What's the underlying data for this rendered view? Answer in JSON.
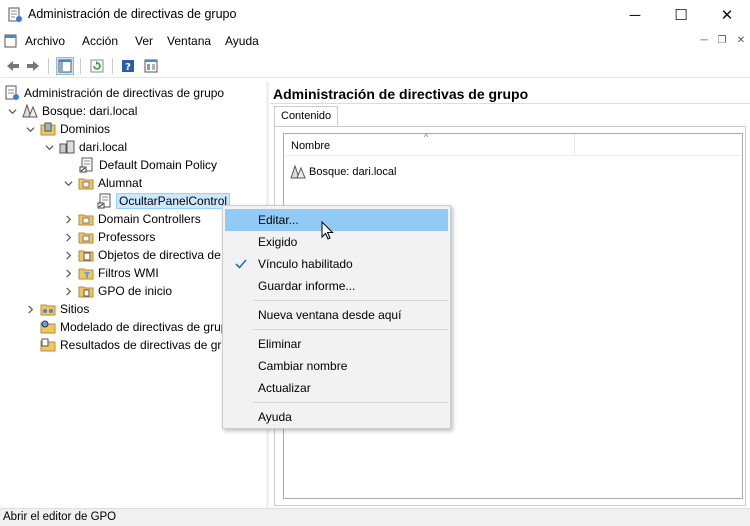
{
  "window": {
    "title": "Administración de directivas de grupo",
    "minimize_glyph": "─",
    "maximize_glyph": "☐",
    "close_glyph": "✕"
  },
  "menubar": {
    "items": [
      "Archivo",
      "Acción",
      "Ver",
      "Ventana",
      "Ayuda"
    ],
    "mdi_minimize_glyph": "─",
    "mdi_restore_glyph": "❐",
    "mdi_close_glyph": "✕"
  },
  "toolbar": {
    "buttons": [
      "back-icon",
      "forward-icon",
      "show-tree-icon",
      "refresh-icon",
      "help-icon",
      "properties-icon"
    ]
  },
  "tree": {
    "root": "Administración de directivas de grupo",
    "forest": "Bosque: dari.local",
    "domains": "Dominios",
    "domain": "dari.local",
    "default_policy": "Default Domain Policy",
    "alumnat": "Alumnat",
    "ocultar": "OcultarPanelControl",
    "domain_controllers": "Domain Controllers",
    "professors": "Professors",
    "gpo_objects": "Objetos de directiva de grupo",
    "wmi_filters": "Filtros WMI",
    "starter_gpos": "GPO de inicio",
    "sites": "Sitios",
    "modeling": "Modelado de directivas de grupo",
    "results": "Resultados de directivas de grupo"
  },
  "right": {
    "title": "Administración de directivas de grupo",
    "tab": "Contenido",
    "column_name": "Nombre",
    "sort_glyph": "^",
    "row": "Bosque: dari.local"
  },
  "context_menu": {
    "edit": "Editar...",
    "enforced": "Exigido",
    "link_enabled": "Vínculo habilitado",
    "save_report": "Guardar informe...",
    "new_window": "Nueva ventana desde aquí",
    "delete": "Eliminar",
    "rename": "Cambiar nombre",
    "refresh": "Actualizar",
    "help": "Ayuda"
  },
  "status": {
    "text": "Abrir el editor de GPO"
  },
  "colors": {
    "hover": "#91c9f7",
    "selection": "#cce8ff",
    "check": "#1a73c9"
  }
}
